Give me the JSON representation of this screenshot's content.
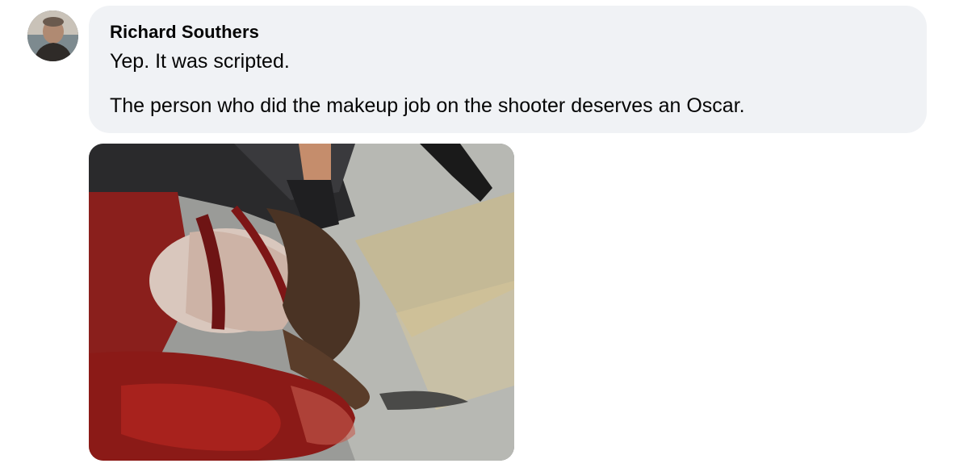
{
  "comment": {
    "author": "Richard Southers",
    "lines": [
      "Yep. It was scripted.",
      "The person who did the makeup job on the shooter deserves an Oscar."
    ]
  },
  "icons": {
    "avatar": "profile-photo",
    "attachment": "photo-attachment"
  },
  "colors": {
    "bubble_background": "#f0f2f5",
    "text": "#050505",
    "page_background": "#ffffff"
  }
}
